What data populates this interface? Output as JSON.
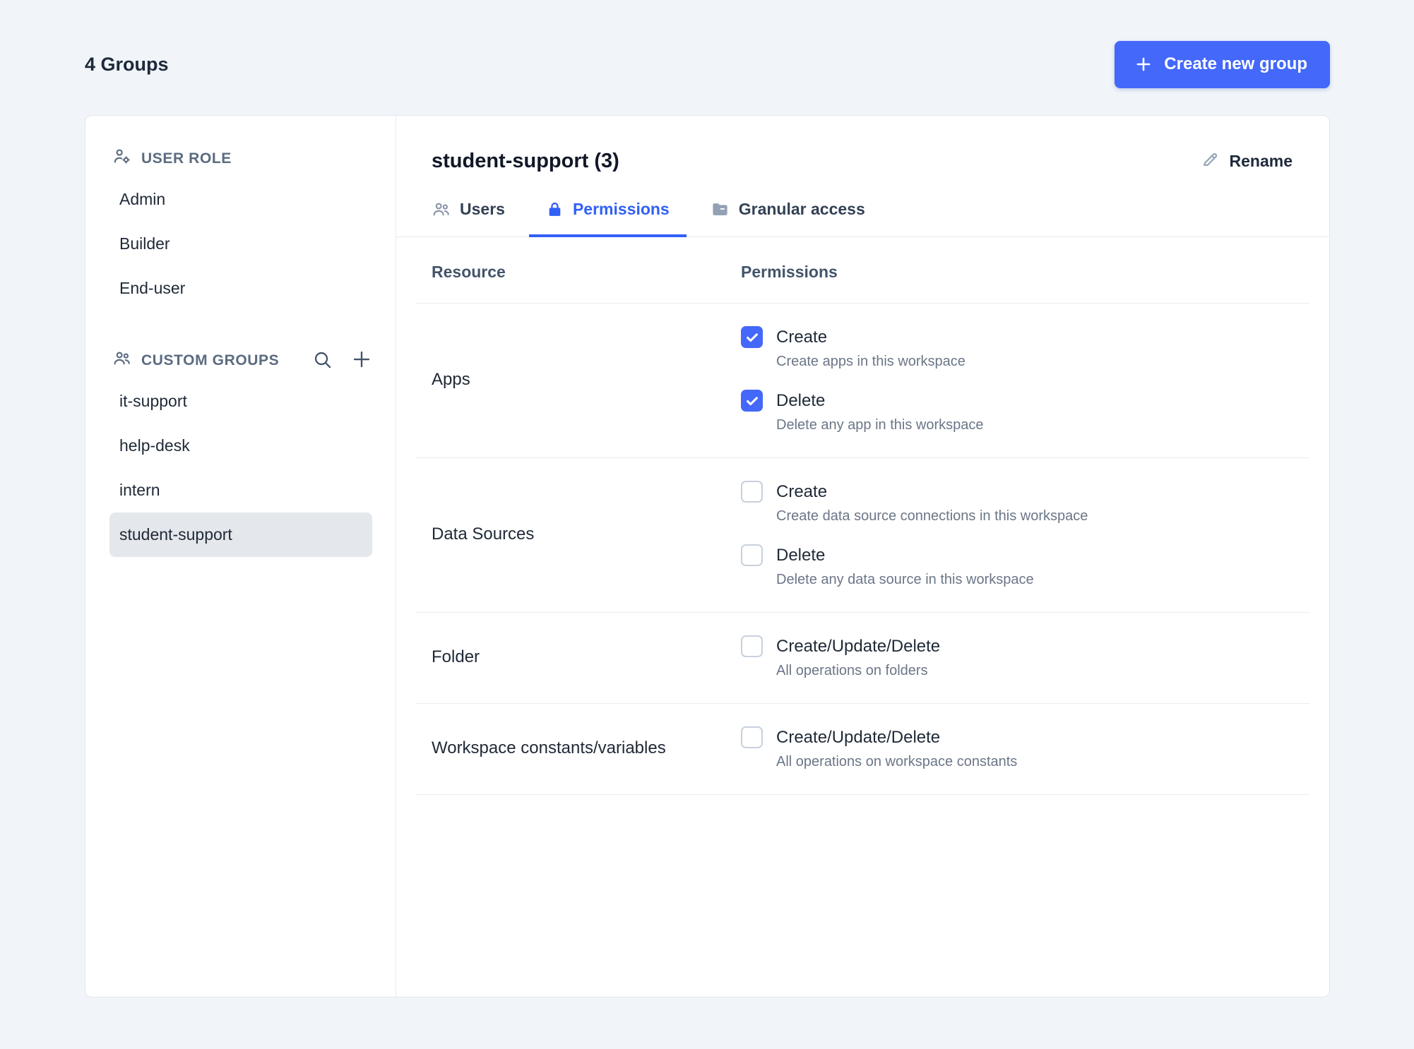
{
  "page": {
    "title": "4 Groups",
    "create_button_label": "Create new group"
  },
  "sidebar": {
    "user_role": {
      "header": "USER ROLE",
      "items": [
        {
          "label": "Admin",
          "selected": false
        },
        {
          "label": "Builder",
          "selected": false
        },
        {
          "label": "End-user",
          "selected": false
        }
      ]
    },
    "custom_groups": {
      "header": "CUSTOM GROUPS",
      "items": [
        {
          "label": "it-support",
          "selected": false
        },
        {
          "label": "help-desk",
          "selected": false
        },
        {
          "label": "intern",
          "selected": false
        },
        {
          "label": "student-support",
          "selected": true
        }
      ]
    }
  },
  "content": {
    "title": "student-support (3)",
    "rename_label": "Rename",
    "tabs": [
      {
        "label": "Users",
        "active": false
      },
      {
        "label": "Permissions",
        "active": true
      },
      {
        "label": "Granular access",
        "active": false
      }
    ],
    "table": {
      "headers": {
        "resource": "Resource",
        "permissions": "Permissions"
      },
      "rows": [
        {
          "resource": "Apps",
          "permissions": [
            {
              "label": "Create",
              "description": "Create apps in this workspace",
              "checked": true
            },
            {
              "label": "Delete",
              "description": "Delete any app in this workspace",
              "checked": true
            }
          ]
        },
        {
          "resource": "Data Sources",
          "permissions": [
            {
              "label": "Create",
              "description": "Create data source connections in this workspace",
              "checked": false
            },
            {
              "label": "Delete",
              "description": "Delete any data source in this workspace",
              "checked": false
            }
          ]
        },
        {
          "resource": "Folder",
          "permissions": [
            {
              "label": "Create/Update/Delete",
              "description": "All operations on folders",
              "checked": false
            }
          ]
        },
        {
          "resource": "Workspace constants/variables",
          "permissions": [
            {
              "label": "Create/Update/Delete",
              "description": "All operations on workspace constants",
              "checked": false
            }
          ]
        }
      ]
    }
  },
  "colors": {
    "accent": "#4368fa",
    "background": "#f1f5f9",
    "selected_item_bg": "#e4e7eb"
  }
}
